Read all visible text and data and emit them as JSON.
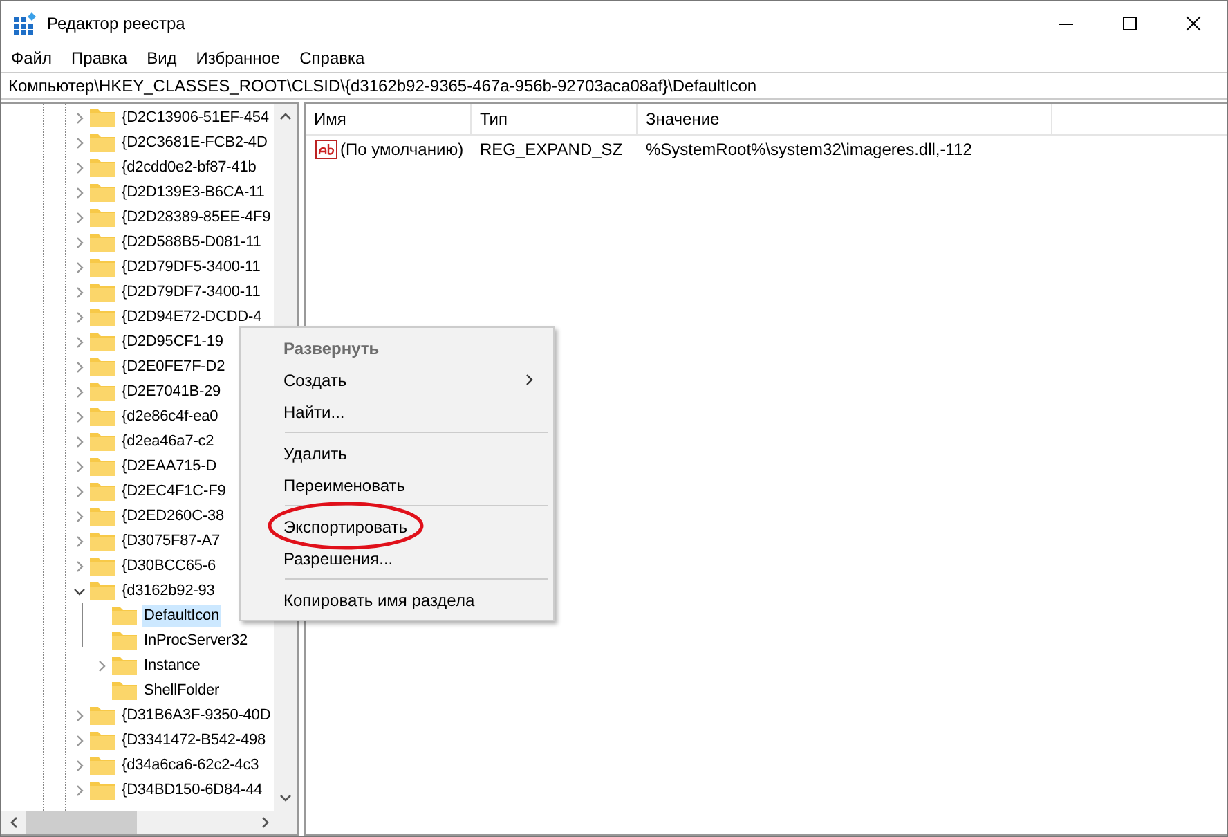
{
  "window": {
    "title": "Редактор реестра"
  },
  "menu_bar": [
    "Файл",
    "Правка",
    "Вид",
    "Избранное",
    "Справка"
  ],
  "address_bar": {
    "value": "Компьютер\\HKEY_CLASSES_ROOT\\CLSID\\{d3162b92-9365-467a-956b-92703aca08af}\\DefaultIcon"
  },
  "tree": {
    "items": [
      {
        "label": "{D2C13906-51EF-454",
        "expanded": false,
        "selected": false
      },
      {
        "label": "{D2C3681E-FCB2-4D",
        "expanded": false,
        "selected": false
      },
      {
        "label": "{d2cdd0e2-bf87-41b",
        "expanded": false,
        "selected": false
      },
      {
        "label": "{D2D139E3-B6CA-11",
        "expanded": false,
        "selected": false
      },
      {
        "label": "{D2D28389-85EE-4F9",
        "expanded": false,
        "selected": false
      },
      {
        "label": "{D2D588B5-D081-11",
        "expanded": false,
        "selected": false
      },
      {
        "label": "{D2D79DF5-3400-11",
        "expanded": false,
        "selected": false
      },
      {
        "label": "{D2D79DF7-3400-11",
        "expanded": false,
        "selected": false
      },
      {
        "label": "{D2D94E72-DCDD-4",
        "expanded": false,
        "selected": false
      },
      {
        "label": "{D2D95CF1-19",
        "expanded": false,
        "selected": false
      },
      {
        "label": "{D2E0FE7F-D2",
        "expanded": false,
        "selected": false
      },
      {
        "label": "{D2E7041B-29",
        "expanded": false,
        "selected": false
      },
      {
        "label": "{d2e86c4f-ea0",
        "expanded": false,
        "selected": false
      },
      {
        "label": "{d2ea46a7-c2",
        "expanded": false,
        "selected": false
      },
      {
        "label": "{D2EAA715-D",
        "expanded": false,
        "selected": false
      },
      {
        "label": "{D2EC4F1C-F9",
        "expanded": false,
        "selected": false
      },
      {
        "label": "{D2ED260C-38",
        "expanded": false,
        "selected": false
      },
      {
        "label": "{D3075F87-A7",
        "expanded": false,
        "selected": false
      },
      {
        "label": "{D30BCC65-6",
        "expanded": false,
        "selected": false
      },
      {
        "label": "{d3162b92-93",
        "expanded": true,
        "selected": false,
        "children": [
          {
            "label": "DefaultIcon",
            "selected": true
          },
          {
            "label": "InProcServer32",
            "selected": false
          },
          {
            "label": "Instance",
            "expanded": false,
            "selected": false
          },
          {
            "label": "ShellFolder",
            "selected": false
          }
        ]
      },
      {
        "label": "{D31B6A3F-9350-40D",
        "expanded": false,
        "selected": false
      },
      {
        "label": "{D3341472-B542-498",
        "expanded": false,
        "selected": false
      },
      {
        "label": "{d34a6ca6-62c2-4c3",
        "expanded": false,
        "selected": false
      },
      {
        "label": "{D34BD150-6D84-44",
        "expanded": false,
        "selected": false
      }
    ]
  },
  "values_table": {
    "columns": [
      "Имя",
      "Тип",
      "Значение"
    ],
    "rows": [
      {
        "name": "(По умолчанию)",
        "type": "REG_EXPAND_SZ",
        "data": "%SystemRoot%\\system32\\imageres.dll,-112"
      }
    ]
  },
  "context_menu": {
    "items": [
      {
        "kind": "item",
        "label": "Развернуть",
        "bold": true,
        "disabled": true,
        "submenu": false,
        "circled": false
      },
      {
        "kind": "item",
        "label": "Создать",
        "bold": false,
        "disabled": false,
        "submenu": true,
        "circled": false
      },
      {
        "kind": "item",
        "label": "Найти...",
        "bold": false,
        "disabled": false,
        "submenu": false,
        "circled": false
      },
      {
        "kind": "separator"
      },
      {
        "kind": "item",
        "label": "Удалить",
        "bold": false,
        "disabled": false,
        "submenu": false,
        "circled": false
      },
      {
        "kind": "item",
        "label": "Переименовать",
        "bold": false,
        "disabled": false,
        "submenu": false,
        "circled": false
      },
      {
        "kind": "separator"
      },
      {
        "kind": "item",
        "label": "Экспортировать",
        "bold": false,
        "disabled": false,
        "submenu": false,
        "circled": true
      },
      {
        "kind": "item",
        "label": "Разрешения...",
        "bold": false,
        "disabled": false,
        "submenu": false,
        "circled": false
      },
      {
        "kind": "separator"
      },
      {
        "kind": "item",
        "label": "Копировать имя раздела",
        "bold": false,
        "disabled": false,
        "submenu": false,
        "circled": false
      }
    ]
  }
}
